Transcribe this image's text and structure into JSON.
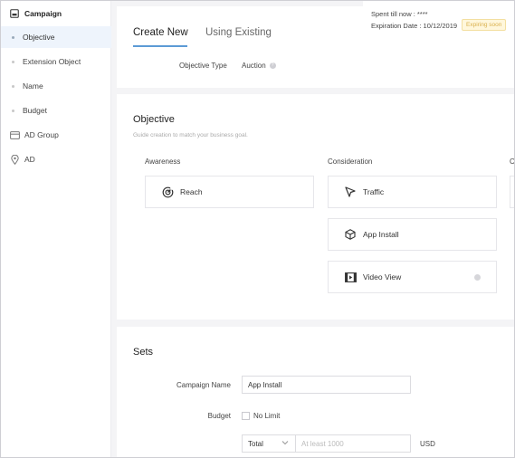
{
  "sidebar": {
    "items": [
      {
        "label": "Campaign",
        "icon": "campaign-icon"
      },
      {
        "label": "Objective"
      },
      {
        "label": "Extension Object"
      },
      {
        "label": "Name"
      },
      {
        "label": "Budget"
      },
      {
        "label": "AD Group",
        "icon": "ad-group-icon"
      },
      {
        "label": "AD",
        "icon": "location-pin-icon"
      }
    ]
  },
  "header": {
    "spent_label": "Spent till now : ****",
    "expiration_label": "Expiration Date : 10/12/2019",
    "badge": "Expiring soon"
  },
  "tabs": [
    {
      "label": "Create New",
      "active": true
    },
    {
      "label": "Using Existing",
      "active": false
    }
  ],
  "objective_type": {
    "label": "Objective Type",
    "value": "Auction"
  },
  "objective": {
    "title": "Objective",
    "subtitle": "Guide creation to match your business goal.",
    "columns": [
      {
        "heading": "Awareness",
        "cards": [
          {
            "label": "Reach",
            "icon": "reach-target-icon"
          }
        ]
      },
      {
        "heading": "Consideration",
        "cards": [
          {
            "label": "Traffic",
            "icon": "cursor-arrow-icon"
          },
          {
            "label": "App Install",
            "icon": "cube-icon"
          },
          {
            "label": "Video View",
            "icon": "film-icon"
          }
        ]
      },
      {
        "heading": "C"
      }
    ]
  },
  "sets": {
    "title": "Sets",
    "campaign_name_label": "Campaign Name",
    "campaign_name_value": "App Install",
    "budget_label": "Budget",
    "no_limit_label": "No Limit",
    "budget_type": "Total",
    "budget_placeholder": "At least 1000",
    "currency": "USD"
  },
  "colors": {
    "accent": "#5c9bd5",
    "active_bg": "#eef4fc",
    "badge_bg": "#fff7dc",
    "badge_text": "#d9b04c"
  }
}
